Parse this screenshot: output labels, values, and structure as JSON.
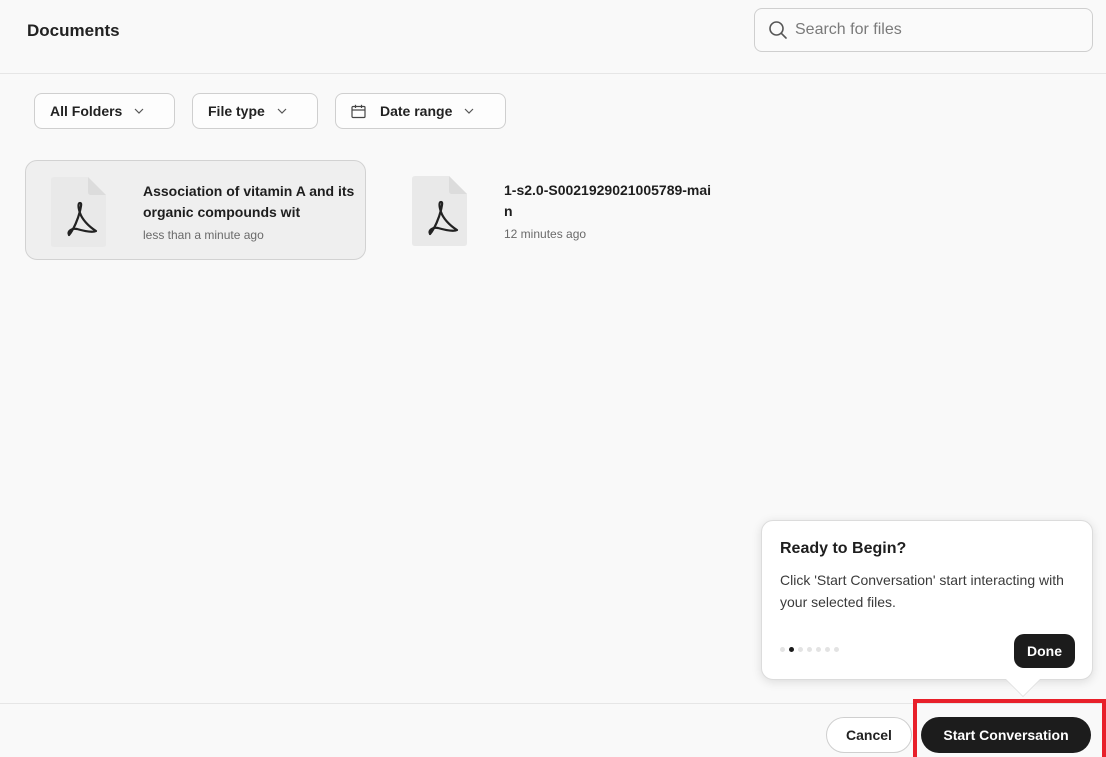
{
  "header": {
    "title": "Documents",
    "search_placeholder": "Search for files",
    "search_value": ""
  },
  "filters": {
    "folders_label": "All Folders",
    "file_type_label": "File type",
    "date_range_label": "Date range"
  },
  "files": [
    {
      "name": "Association of vitamin A and its organic compounds wit",
      "time": "less than a minute ago",
      "icon": "pdf-file-icon",
      "selected": true
    },
    {
      "name": "1-s2.0-S0021929021005789-main",
      "time": "12 minutes ago",
      "icon": "pdf-file-icon",
      "selected": false
    }
  ],
  "tooltip": {
    "title": "Ready to Begin?",
    "body": "Click 'Start Conversation' start interacting with your selected files.",
    "done_label": "Done",
    "step_count": 7,
    "active_step": 2
  },
  "footer": {
    "cancel_label": "Cancel",
    "start_label": "Start Conversation"
  },
  "colors": {
    "primary_button": "#1c1c1c",
    "highlight": "#e8202a"
  }
}
